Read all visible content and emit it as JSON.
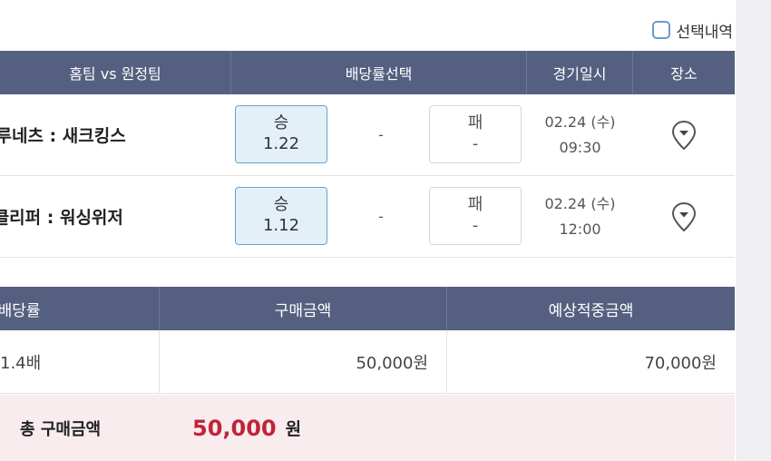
{
  "select_history": {
    "label": "선택내역"
  },
  "match_header": {
    "teams": "홈팀 vs 원정팀",
    "odds": "배당률선택",
    "time": "경기일시",
    "venue": "장소"
  },
  "matches": [
    {
      "teams": "브루네츠 : 새크킹스",
      "win_label": "승",
      "win_odds": "1.22",
      "draw": "-",
      "loss_label": "패",
      "loss_odds": "-",
      "date": "02.24 (수)",
      "time": "09:30",
      "venue_icon": "location-pin-icon"
    },
    {
      "teams": "A클리퍼 : 워싱위저",
      "win_label": "승",
      "win_odds": "1.12",
      "draw": "-",
      "loss_label": "패",
      "loss_odds": "-",
      "date": "02.24 (수)",
      "time": "12:00",
      "venue_icon": "location-pin-icon"
    }
  ],
  "summary": {
    "headers": [
      "상배당률",
      "구매금액",
      "예상적중금액"
    ],
    "values": [
      "1.4배",
      "50,000원",
      "70,000원"
    ]
  },
  "total": {
    "label": "총 구매금액",
    "amount": "50,000",
    "unit": "원"
  },
  "colors": {
    "header_bg": "#556080",
    "selected_bg": "#e3f0f8",
    "selected_border": "#6aa4c4",
    "total_bg": "#f8ecee",
    "total_amount": "#c0243a"
  }
}
